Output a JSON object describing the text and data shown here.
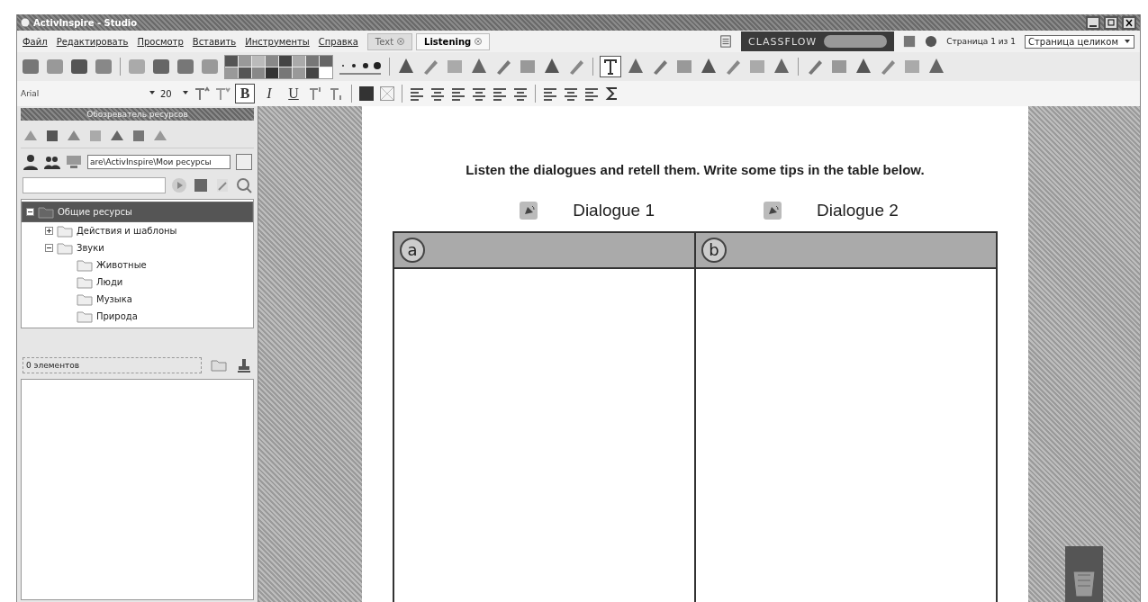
{
  "window": {
    "title": "ActivInspire - Studio"
  },
  "menu": [
    "Файл",
    "Редактировать",
    "Просмотр",
    "Вставить",
    "Инструменты",
    "Справка"
  ],
  "tabs": [
    {
      "label": "Text",
      "selected": false
    },
    {
      "label": "Listening",
      "selected": true
    }
  ],
  "classflow": {
    "label": "CLASSFLOW"
  },
  "page_indicator": "Страница 1 из 1",
  "zoom_select": {
    "value": "Страница целиком"
  },
  "format_bar": {
    "font": "Arial",
    "size": "20",
    "bold_label": "B",
    "italic_label": "I",
    "underline_label": "U",
    "bold": true,
    "italic": false,
    "underline": false
  },
  "resource_browser": {
    "title": "Обозреватель ресурсов",
    "path": "are\\ActivInspire\\Мои ресурсы",
    "tree": [
      {
        "label": "Общие ресурсы",
        "selected": true,
        "expanded": true,
        "children": [
          {
            "label": "Действия и шаблоны",
            "selected": false,
            "expanded": false
          },
          {
            "label": "Звуки",
            "selected": false,
            "expanded": true,
            "children": [
              {
                "label": "Животные",
                "selected": false
              },
              {
                "label": "Люди",
                "selected": false
              },
              {
                "label": "Музыка",
                "selected": false
              },
              {
                "label": "Природа",
                "selected": false
              }
            ]
          }
        ]
      }
    ],
    "count": "0 элементов"
  },
  "page": {
    "instruction": "Listen the dialogues and retell them. Write some tips in the table below.",
    "dialogues": [
      "Dialogue 1",
      "Dialogue 2"
    ],
    "table_columns": [
      "a",
      "b"
    ]
  }
}
